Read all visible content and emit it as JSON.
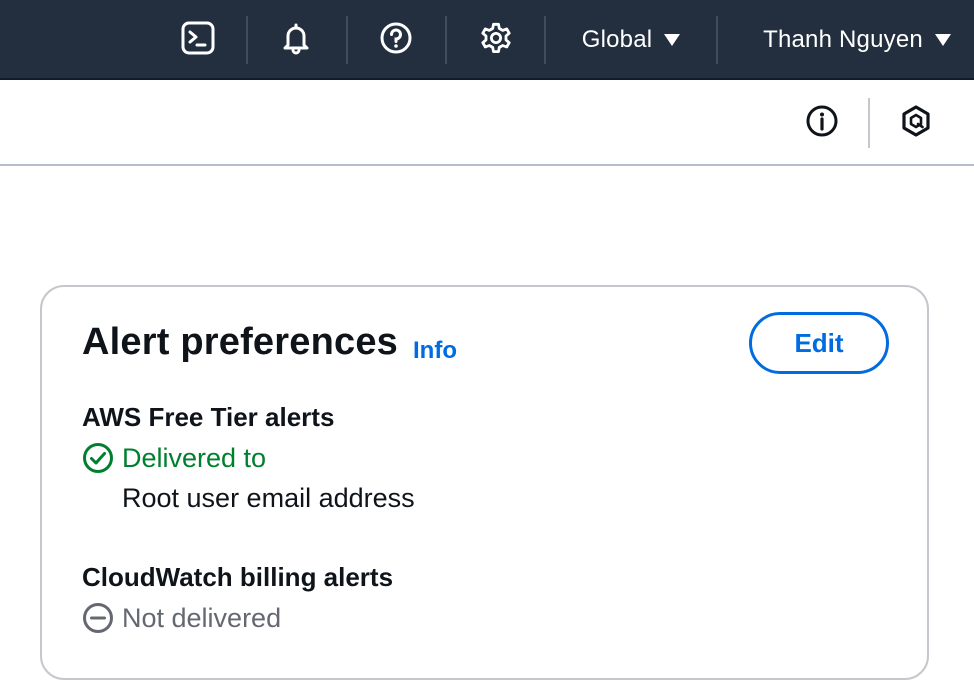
{
  "topbar": {
    "icons": {
      "cloudshell": "cloudshell-icon",
      "notifications": "bell-icon",
      "help": "help-icon",
      "settings": "gear-icon"
    },
    "region_label": "Global",
    "user_label": "Thanh Nguyen"
  },
  "toolbar": {
    "icons": {
      "info": "info-icon",
      "assistant": "q-assistant-icon"
    }
  },
  "alert_preferences": {
    "title": "Alert preferences",
    "info_link": "Info",
    "edit_label": "Edit",
    "free_tier": {
      "heading": "AWS Free Tier alerts",
      "status": "Delivered to",
      "recipient": "Root user email address"
    },
    "cloudwatch": {
      "heading": "CloudWatch billing alerts",
      "status": "Not delivered"
    }
  },
  "colors": {
    "nav_background": "#232f3e",
    "link_blue": "#006ce0",
    "success_green": "#00802f",
    "neutral_grey": "#656871",
    "card_border": "#c6c6cd"
  }
}
